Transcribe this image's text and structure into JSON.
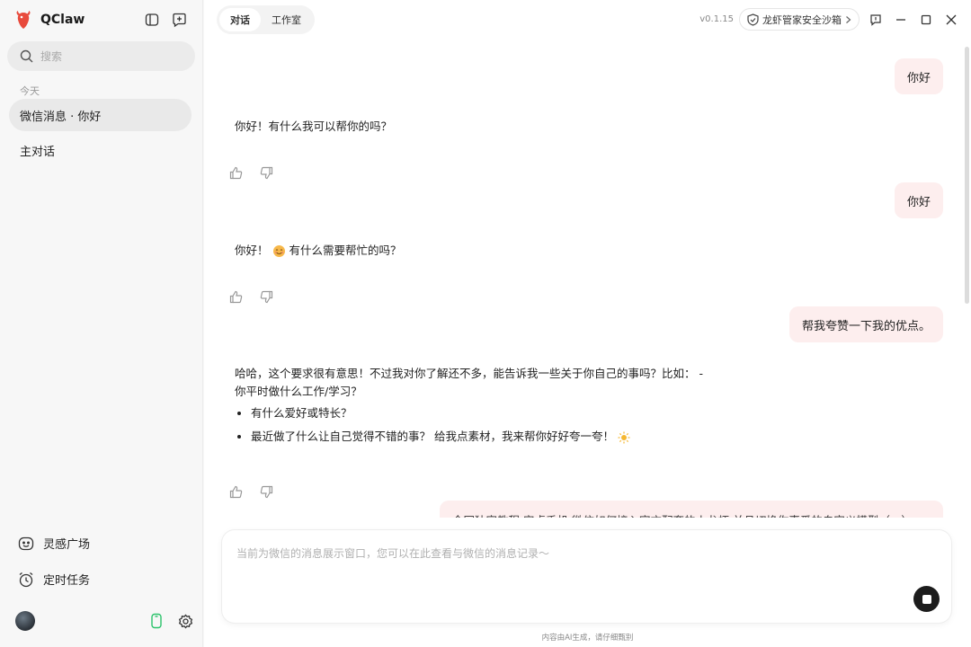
{
  "app": {
    "name": "QClaw",
    "version": "v0.1.15",
    "accent_color": "#e84a3c"
  },
  "sidebar": {
    "search": {
      "placeholder": "搜索"
    },
    "section_today": "今天",
    "conversations": [
      {
        "label": "微信消息 · 你好",
        "active": true
      },
      {
        "label": "主对话",
        "active": false
      }
    ],
    "bottom_items": [
      {
        "label": "灵感广场",
        "icon": "smile-box-icon"
      },
      {
        "label": "定时任务",
        "icon": "alarm-clock-icon"
      }
    ]
  },
  "header": {
    "tabs": [
      {
        "label": "对话",
        "active": true
      },
      {
        "label": "工作室",
        "active": false
      }
    ],
    "sandbox_label": "龙虾管家安全沙箱"
  },
  "chat": {
    "messages": [
      {
        "role": "user",
        "text": "你好"
      },
      {
        "role": "ai",
        "text": "你好！有什么我可以帮你的吗？"
      },
      {
        "role": "user",
        "text": "你好"
      },
      {
        "role": "ai",
        "text_before": "你好！",
        "text_after": "有什么需要帮忙的吗？"
      },
      {
        "role": "user",
        "text": "帮我夸赞一下我的优点。"
      },
      {
        "role": "ai",
        "line1": "哈哈，这个要求很有意思！不过我对你了解还不多，能告诉我一些关于你自己的事吗？比如：  -",
        "line2": "你平时做什么工作/学习？",
        "bullets": [
          "有什么爱好或特长？",
          "最近做了什么让自己觉得不错的事？ 给我点素材，我来帮你好好夸一夸！"
        ]
      },
      {
        "role": "user",
        "text": "全网独家教程 安卓手机 微信如何接入官方配套的小龙虾 并且切换你喜爱的自定义模型（…）"
      }
    ]
  },
  "composer": {
    "placeholder": "当前为微信的消息展示窗口，您可以在此查看与微信的消息记录～"
  },
  "footer": {
    "disclaimer": "内容由AI生成，请仔细甄别"
  }
}
